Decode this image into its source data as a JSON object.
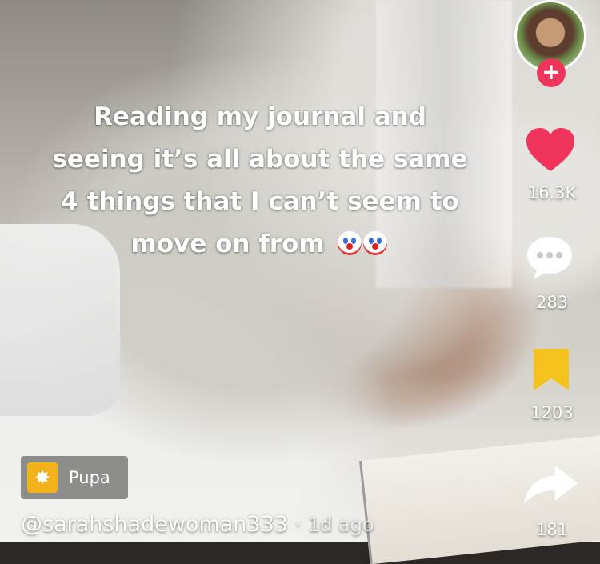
{
  "video": {
    "caption_lines": [
      "Reading my journal and",
      "seeing it’s all about the same",
      "4 things that I can’t seem to",
      "move on from"
    ],
    "caption_emoji": "clown-face",
    "caption_emoji_count": 2
  },
  "rail": {
    "avatar_icon": "creator-avatar",
    "follow_symbol": "+",
    "like_count": "16.3K",
    "comment_count": "283",
    "save_count": "1203",
    "share_count": "181"
  },
  "effect": {
    "icon": "sparkle-icon",
    "label": "Pupa"
  },
  "byline": {
    "username": "@sarahshadewoman333",
    "separator": "·",
    "time": "1d ago"
  },
  "colors": {
    "like": "#f0355c",
    "save": "#f3c21c",
    "follow": "#f0355c",
    "effect": "#f3b21c"
  }
}
